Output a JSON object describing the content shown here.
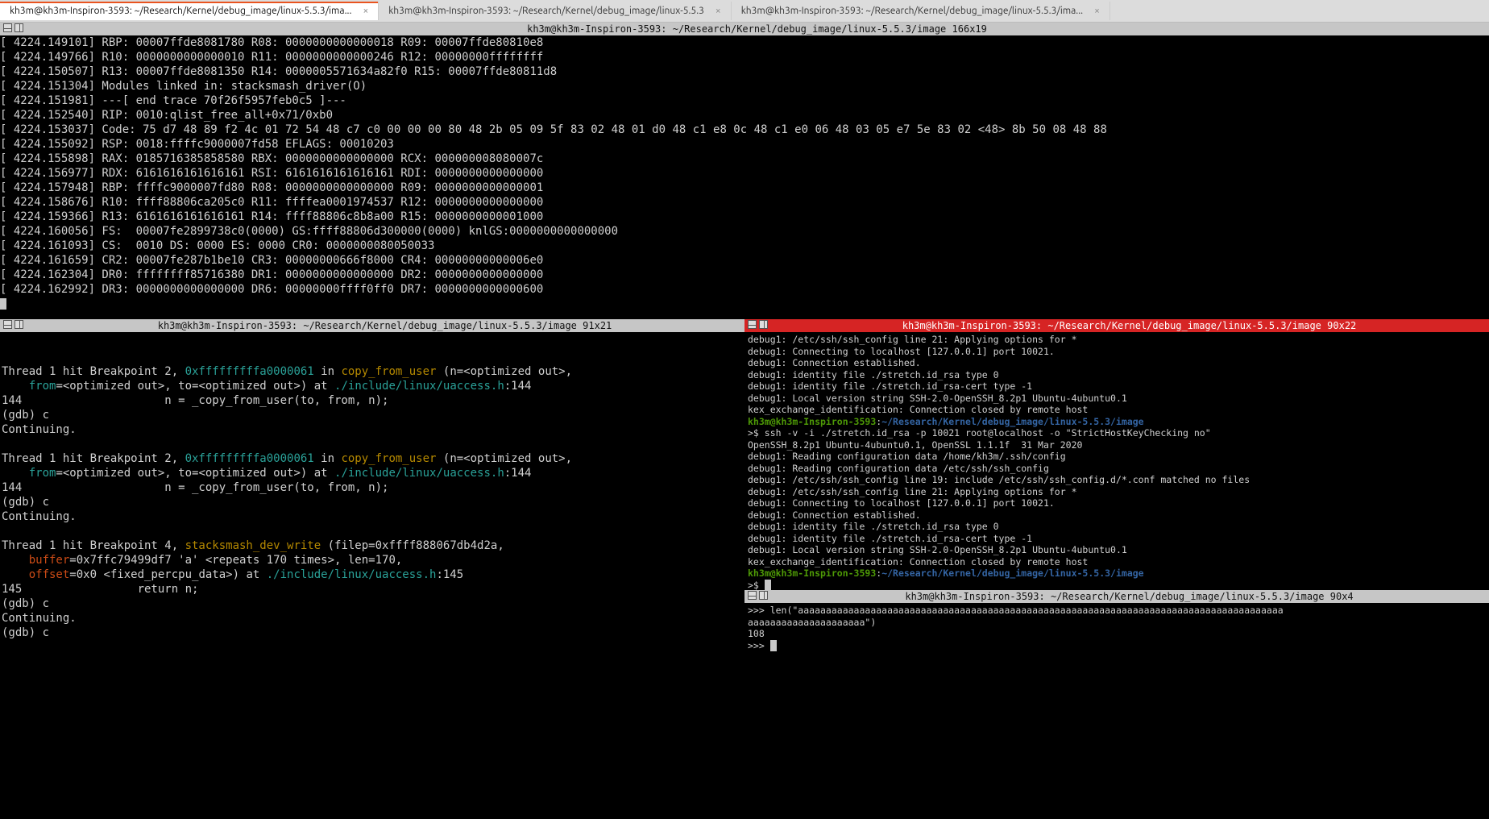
{
  "tabs": [
    {
      "label": "kh3m@kh3m-Inspiron-3593: ~/Research/Kernel/debug_image/linux-5.5.3/ima...",
      "active": true
    },
    {
      "label": "kh3m@kh3m-Inspiron-3593: ~/Research/Kernel/debug_image/linux-5.5.3",
      "active": false
    },
    {
      "label": "kh3m@kh3m-Inspiron-3593: ~/Research/Kernel/debug_image/linux-5.5.3/ima...",
      "active": false
    }
  ],
  "close_glyph": "×",
  "pane_top": {
    "title": "kh3m@kh3m-Inspiron-3593: ~/Research/Kernel/debug_image/linux-5.5.3/image",
    "dims": "166x19",
    "lines": [
      "[ 4224.149101] RBP: 00007ffde8081780 R08: 0000000000000018 R09: 00007ffde80810e8",
      "[ 4224.149766] R10: 0000000000000010 R11: 0000000000000246 R12: 00000000ffffffff",
      "[ 4224.150507] R13: 00007ffde8081350 R14: 0000005571634a82f0 R15: 00007ffde80811d8",
      "[ 4224.151304] Modules linked in: stacksmash_driver(O)",
      "[ 4224.151981] ---[ end trace 70f26f5957feb0c5 ]---",
      "[ 4224.152540] RIP: 0010:qlist_free_all+0x71/0xb0",
      "[ 4224.153037] Code: 75 d7 48 89 f2 4c 01 72 54 48 c7 c0 00 00 00 80 48 2b 05 09 5f 83 02 48 01 d0 48 c1 e8 0c 48 c1 e0 06 48 03 05 e7 5e 83 02 <48> 8b 50 08 48 88",
      "[ 4224.155092] RSP: 0018:ffffc9000007fd58 EFLAGS: 00010203",
      "[ 4224.155898] RAX: 0185716385858580 RBX: 0000000000000000 RCX: 000000008080007c",
      "[ 4224.156977] RDX: 6161616161616161 RSI: 6161616161616161 RDI: 0000000000000000",
      "[ 4224.157948] RBP: ffffc9000007fd80 R08: 0000000000000000 R09: 0000000000000001",
      "[ 4224.158676] R10: ffff88806ca205c0 R11: ffffea0001974537 R12: 0000000000000000",
      "[ 4224.159366] R13: 6161616161616161 R14: ffff88806c8b8a00 R15: 0000000000001000",
      "[ 4224.160056] FS:  00007fe2899738c0(0000) GS:ffff88806d300000(0000) knlGS:0000000000000000",
      "[ 4224.161093] CS:  0010 DS: 0000 ES: 0000 CR0: 0000000080050033",
      "[ 4224.161659] CR2: 00007fe287b1be10 CR3: 00000000666f8000 CR4: 00000000000006e0",
      "[ 4224.162304] DR0: ffffffff85716380 DR1: 0000000000000000 DR2: 0000000000000000",
      "[ 4224.162992] DR3: 0000000000000000 DR6: 00000000ffff0ff0 DR7: 0000000000000600",
      ""
    ]
  },
  "pane_gdb": {
    "title": "kh3m@kh3m-Inspiron-3593: ~/Research/Kernel/debug_image/linux-5.5.3/image",
    "dims": "91x21",
    "bp1_prefix": "Thread 1 hit Breakpoint 2, ",
    "bp1_addr": "0xfffffffffa0000061",
    "bp1_in": " in ",
    "bp1_func": "copy_from_user",
    "bp1_args": " (n=<optimized out>,",
    "bp1_line2a": "    from",
    "bp1_line2b": "=<optimized out>, to",
    "bp1_line2c": "=<optimized out>) at ",
    "bp1_path": "./include/linux/uaccess.h",
    "bp1_lineno": ":144",
    "bp1_src": "144                     n = _copy_from_user(to, from, n);",
    "gdb_c": "(gdb) c",
    "continuing": "Continuing.",
    "bp3_prefix": "Thread 1 hit Breakpoint 4, ",
    "bp3_func": "stacksmash_dev_write",
    "bp3_args": " (filep",
    "bp3_args_val": "=0xffff888067db4d2a,",
    "bp3_l2a": "    buffer",
    "bp3_l2b": "=0x7ffc79499df7 'a' <repeats 170 times>, len",
    "bp3_l2c": "=170,",
    "bp3_l3a": "    offset",
    "bp3_l3b": "=0x0 <fixed_percpu_data>) at ",
    "bp3_path": "./include/linux/uaccess.h",
    "bp3_lineno": ":145",
    "bp3_src": "145                 return n;",
    "gdb_c2": "(gdb) c"
  },
  "pane_ssh": {
    "title": "kh3m@kh3m-Inspiron-3593: ~/Research/Kernel/debug_image/linux-5.5.3/image",
    "dims": "90x22",
    "lines_a": [
      "debug1: /etc/ssh/ssh_config line 21: Applying options for *",
      "debug1: Connecting to localhost [127.0.0.1] port 10021.",
      "debug1: Connection established.",
      "debug1: identity file ./stretch.id_rsa type 0",
      "debug1: identity file ./stretch.id_rsa-cert type -1",
      "debug1: Local version string SSH-2.0-OpenSSH_8.2p1 Ubuntu-4ubuntu0.1",
      "kex_exchange_identification: Connection closed by remote host"
    ],
    "prompt_user": "kh3m@kh3m-Inspiron-3593",
    "prompt_colon": ":",
    "prompt_path": "~/Research/Kernel/debug_image/linux-5.5.3/image",
    "cmd": ">$ ssh -v -i ./stretch.id_rsa -p 10021 root@localhost -o \"StrictHostKeyChecking no\"",
    "lines_b": [
      "OpenSSH_8.2p1 Ubuntu-4ubuntu0.1, OpenSSL 1.1.1f  31 Mar 2020",
      "debug1: Reading configuration data /home/kh3m/.ssh/config",
      "debug1: Reading configuration data /etc/ssh/ssh_config",
      "debug1: /etc/ssh/ssh_config line 19: include /etc/ssh/ssh_config.d/*.conf matched no files",
      "debug1: /etc/ssh/ssh_config line 21: Applying options for *",
      "debug1: Connecting to localhost [127.0.0.1] port 10021.",
      "debug1: Connection established.",
      "debug1: identity file ./stretch.id_rsa type 0",
      "debug1: identity file ./stretch.id_rsa-cert type -1",
      "debug1: Local version string SSH-2.0-OpenSSH_8.2p1 Ubuntu-4ubuntu0.1",
      "kex_exchange_identification: Connection closed by remote host"
    ],
    "prompt2": ">$ "
  },
  "pane_py": {
    "title": "kh3m@kh3m-Inspiron-3593: ~/Research/Kernel/debug_image/linux-5.5.3/image",
    "dims": "90x4",
    "lines": [
      ">>> len(\"aaaaaaaaaaaaaaaaaaaaaaaaaaaaaaaaaaaaaaaaaaaaaaaaaaaaaaaaaaaaaaaaaaaaaaaaaaaaaaaaaaaaaaa",
      "aaaaaaaaaaaaaaaaaaaaa\")",
      "108",
      ">>> "
    ]
  }
}
